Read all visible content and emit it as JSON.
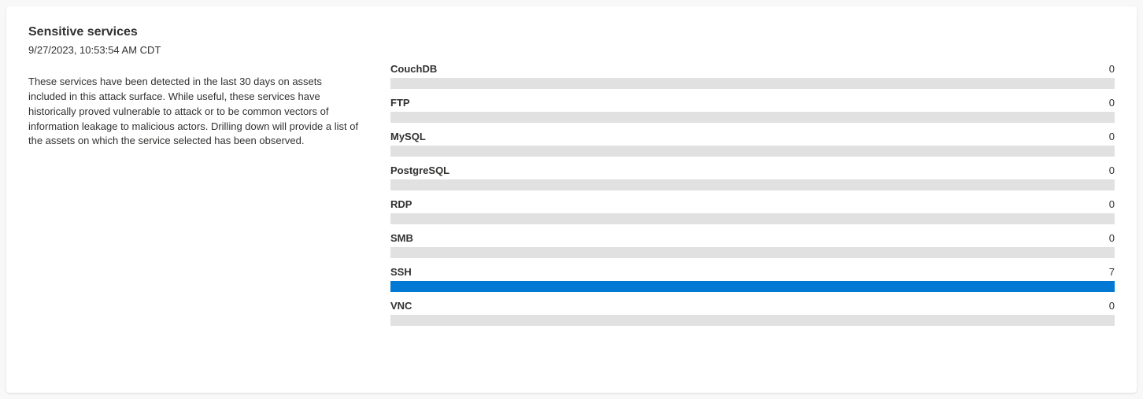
{
  "card": {
    "title": "Sensitive services",
    "timestamp": "9/27/2023, 10:53:54 AM CDT",
    "description": "These services have been detected in the last 30 days on assets included in this attack surface. While useful, these services have historically proved vulnerable to attack or to be common vectors of information leakage to malicious actors. Drilling down will provide a list of the assets on which the service selected has been observed."
  },
  "chart_data": {
    "type": "bar",
    "orientation": "horizontal",
    "max": 7,
    "accent_color": "#0078d4",
    "track_color": "#e1e1e1",
    "series": [
      {
        "name": "CouchDB",
        "value": 0
      },
      {
        "name": "FTP",
        "value": 0
      },
      {
        "name": "MySQL",
        "value": 0
      },
      {
        "name": "PostgreSQL",
        "value": 0
      },
      {
        "name": "RDP",
        "value": 0
      },
      {
        "name": "SMB",
        "value": 0
      },
      {
        "name": "SSH",
        "value": 7
      },
      {
        "name": "VNC",
        "value": 0
      }
    ]
  }
}
